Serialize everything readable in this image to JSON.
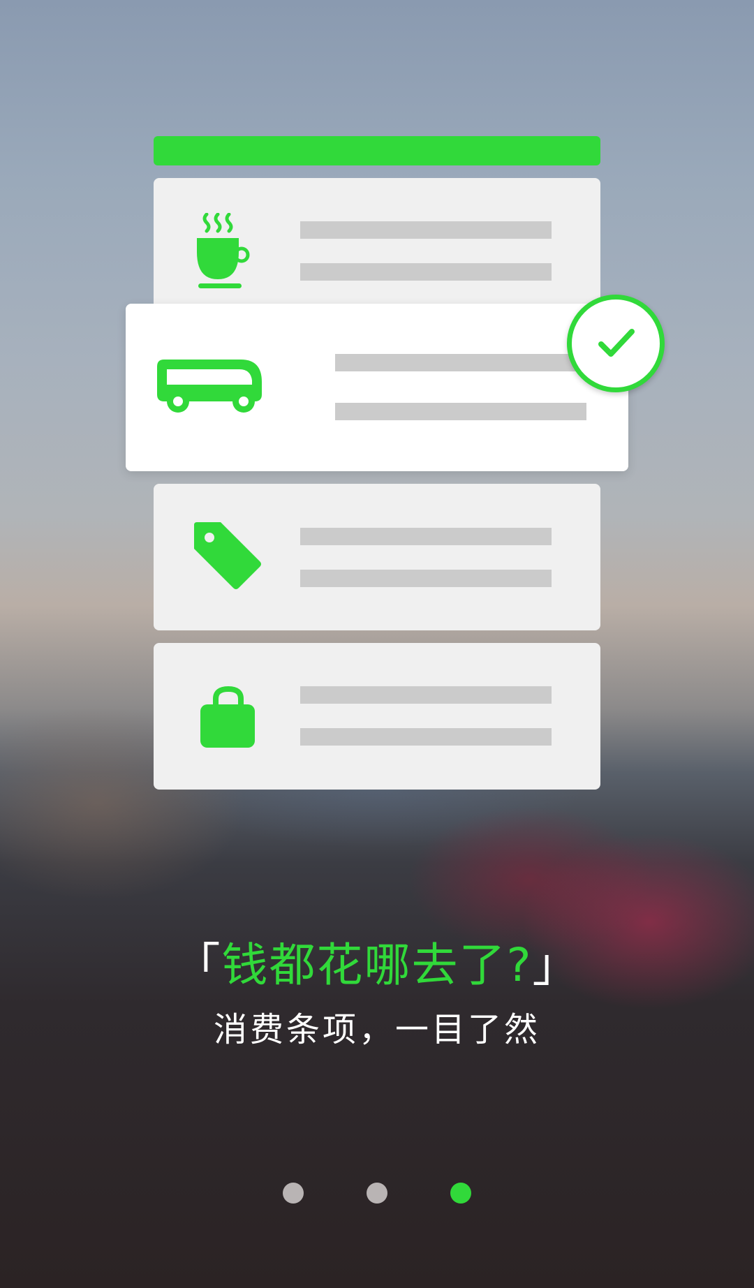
{
  "colors": {
    "accent": "#31d93a",
    "card": "#f0f0f0",
    "highlight_card": "#ffffff",
    "placeholder": "#cbcbcb",
    "dot_inactive": "#b9b4b4"
  },
  "list": {
    "items": [
      {
        "icon": "coffee-cup-icon"
      },
      {
        "icon": "bus-icon",
        "selected": true
      },
      {
        "icon": "price-tag-icon"
      },
      {
        "icon": "lock-icon"
      }
    ]
  },
  "slogan": {
    "open_quote": "「",
    "headline": "钱都花哪去了?",
    "close_quote": "」",
    "subtitle": "消费条项，一目了然"
  },
  "pager": {
    "count": 3,
    "active_index": 2
  }
}
